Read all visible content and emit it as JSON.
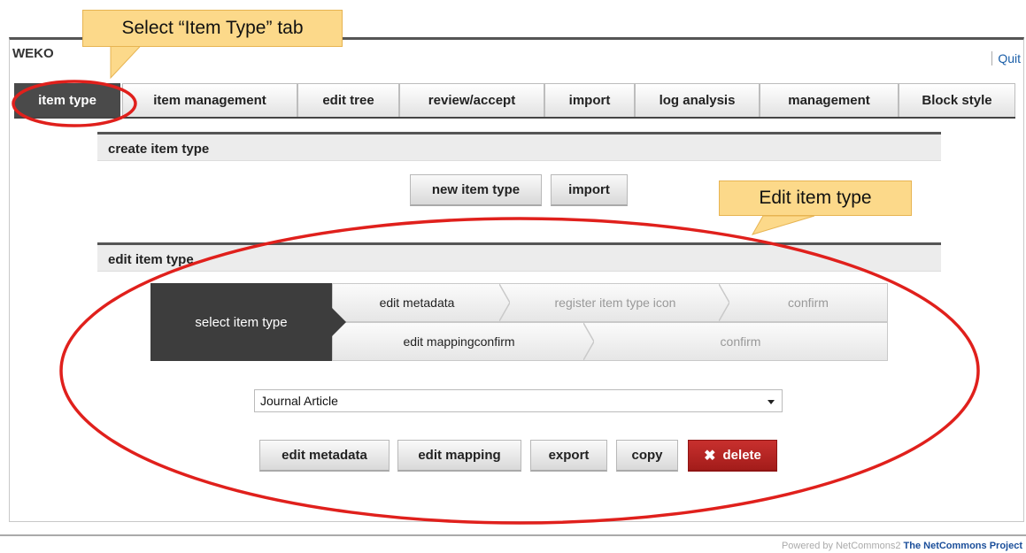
{
  "app": {
    "title": "WEKO",
    "quit_label": "Quit"
  },
  "tabs": [
    {
      "label": "item type",
      "active": true
    },
    {
      "label": "item management"
    },
    {
      "label": "edit tree"
    },
    {
      "label": "review/accept"
    },
    {
      "label": "import"
    },
    {
      "label": "log analysis"
    },
    {
      "label": "management"
    },
    {
      "label": "Block style"
    }
  ],
  "create_section": {
    "title": "create item type",
    "new_button": "new item type",
    "import_button": "import"
  },
  "edit_section": {
    "title": "edit item type",
    "steps": {
      "active": "select item type",
      "row1": [
        "edit metadata",
        "register item type icon",
        "confirm"
      ],
      "row2": [
        "edit mappingconfirm",
        "confirm"
      ]
    },
    "select": {
      "value": "Journal Article"
    },
    "buttons": {
      "edit_metadata": "edit metadata",
      "edit_mapping": "edit mapping",
      "export": "export",
      "copy": "copy",
      "delete": "delete"
    }
  },
  "callouts": {
    "tab_hint": "Select “Item Type” tab",
    "edit_hint": "Edit item type"
  },
  "footer": {
    "prefix": "Powered by NetCommons2",
    "project": "The NetCommons Project"
  },
  "colors": {
    "annotation_red": "#e0201c",
    "callout_fill": "#fcd98a",
    "danger": "#b3221f"
  },
  "icons": {
    "dropdown": "chevron-down-icon",
    "delete": "close-icon"
  }
}
